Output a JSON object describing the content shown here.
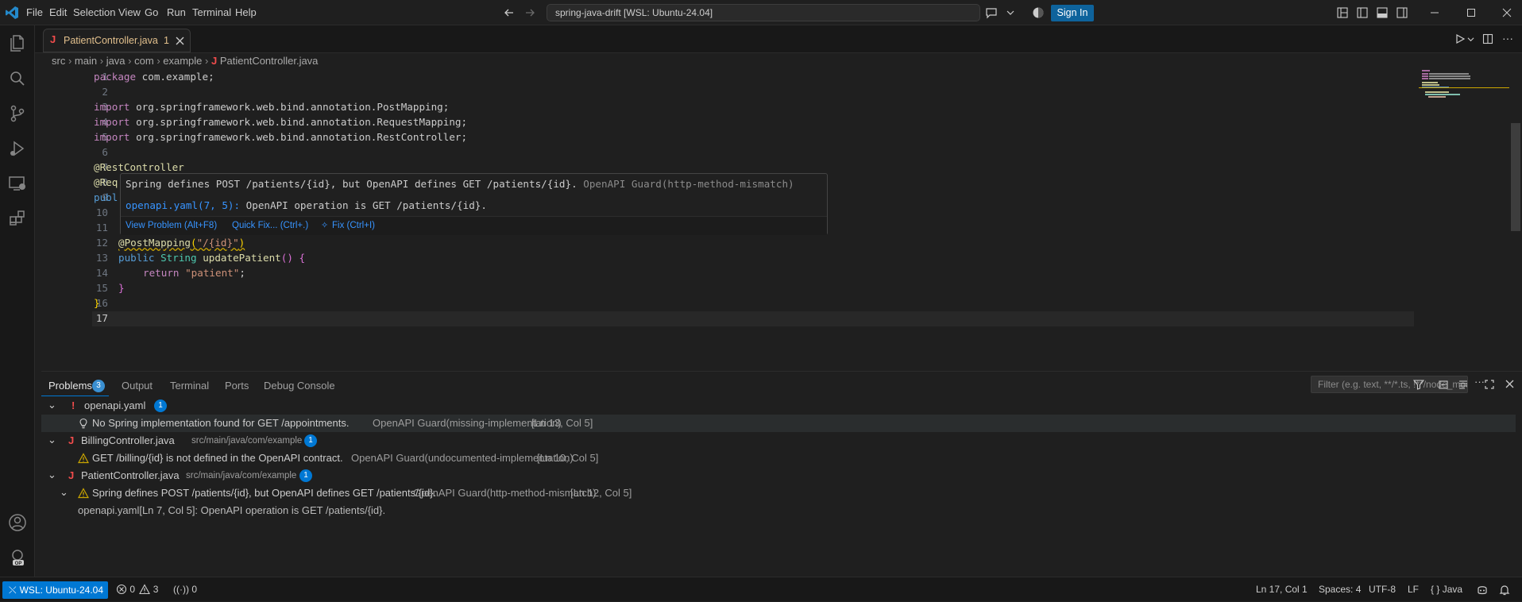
{
  "menu": [
    "File",
    "Edit",
    "Selection",
    "View",
    "Go",
    "Run",
    "Terminal",
    "Help"
  ],
  "command_center": "spring-java-drift [WSL: Ubuntu-24.04]",
  "sign_in": "Sign In",
  "tab": {
    "name": "PatientController.java",
    "problems": "1"
  },
  "breadcrumb": [
    "src",
    "main",
    "java",
    "com",
    "example",
    "PatientController.java"
  ],
  "code_lines": [
    {
      "n": "1"
    },
    {
      "n": "2"
    },
    {
      "n": "3"
    },
    {
      "n": "4"
    },
    {
      "n": "5"
    },
    {
      "n": "6"
    },
    {
      "n": "7"
    },
    {
      "n": "8"
    },
    {
      "n": "9"
    },
    {
      "n": "10"
    },
    {
      "n": "11"
    },
    {
      "n": "12"
    },
    {
      "n": "13"
    },
    {
      "n": "14"
    },
    {
      "n": "15"
    },
    {
      "n": "16"
    },
    {
      "n": "17"
    }
  ],
  "code": {
    "l1_kw": "package",
    "l1_rest": " com.example;",
    "l3_kw": "import",
    "l3_rest": " org.springframework.web.bind.annotation.PostMapping;",
    "l4_kw": "import",
    "l4_rest": " org.springframework.web.bind.annotation.RequestMapping;",
    "l5_kw": "import",
    "l5_rest": " org.springframework.web.bind.annotation.RestController;",
    "l7": "@RestController",
    "l8": "@Req",
    "l9": "publ",
    "l12_an": "@PostMapping",
    "l12_open": "(",
    "l12_str": "\"/{id}\"",
    "l12_close": ")",
    "l13_pub": "public",
    "l13_ty": "String",
    "l13_fn": "updatePatient",
    "l13_paren": "()",
    "l13_brace": "{",
    "l14_kw": "return",
    "l14_str": "\"patient\"",
    "l14_semi": ";",
    "l15": "}",
    "l16": "}"
  },
  "hover": {
    "message": "Spring defines POST /patients/{id}, but OpenAPI defines GET /patients/{id}.",
    "source": "OpenAPI Guard(http-method-mismatch)",
    "related_loc": "openapi.yaml(7, 5):",
    "related_msg": "OpenAPI operation is GET /patients/{id}.",
    "view_problem": "View Problem (Alt+F8)",
    "quick_fix": "Quick Fix... (Ctrl+.)",
    "fix": "Fix (Ctrl+I)"
  },
  "panel": {
    "tabs": [
      "Problems",
      "Output",
      "Terminal",
      "Ports",
      "Debug Console"
    ],
    "problems_count": "3",
    "filter_placeholder": "Filter (e.g. text, **/*.ts, !**/node_modules/**)",
    "groups": [
      {
        "file": "openapi.yaml",
        "path": "",
        "count": "1",
        "items": [
          {
            "message": "No Spring implementation found for GET /appointments.",
            "source": "OpenAPI Guard(missing-implementation)",
            "loc": "[Ln 13, Col 5]"
          }
        ]
      },
      {
        "file": "BillingController.java",
        "path": "src/main/java/com/example",
        "count": "1",
        "items": [
          {
            "message": "GET /billing/{id} is not defined in the OpenAPI contract.",
            "source": "OpenAPI Guard(undocumented-implementation)",
            "loc": "[Ln 10, Col 5]"
          }
        ]
      },
      {
        "file": "PatientController.java",
        "path": "src/main/java/com/example",
        "count": "1",
        "items": [
          {
            "message": "Spring defines POST /patients/{id}, but OpenAPI defines GET /patients/{id}.",
            "source": "OpenAPI Guard(http-method-mismatch)",
            "loc": "[Ln 12, Col 5]",
            "related": "openapi.yaml[Ln 7, Col 5]: OpenAPI operation is GET /patients/{id}."
          }
        ]
      }
    ]
  },
  "status": {
    "remote": "WSL: Ubuntu-24.04",
    "errors": "0",
    "warnings": "3",
    "ports": "0",
    "position": "Ln 17, Col 1",
    "spaces": "Spaces: 4",
    "encoding": "UTF-8",
    "eol": "LF",
    "language": "Java"
  },
  "colors": {
    "accent": "#0078d4",
    "warning": "#cca700",
    "error": "#f14c4c",
    "link": "#3794ff"
  }
}
